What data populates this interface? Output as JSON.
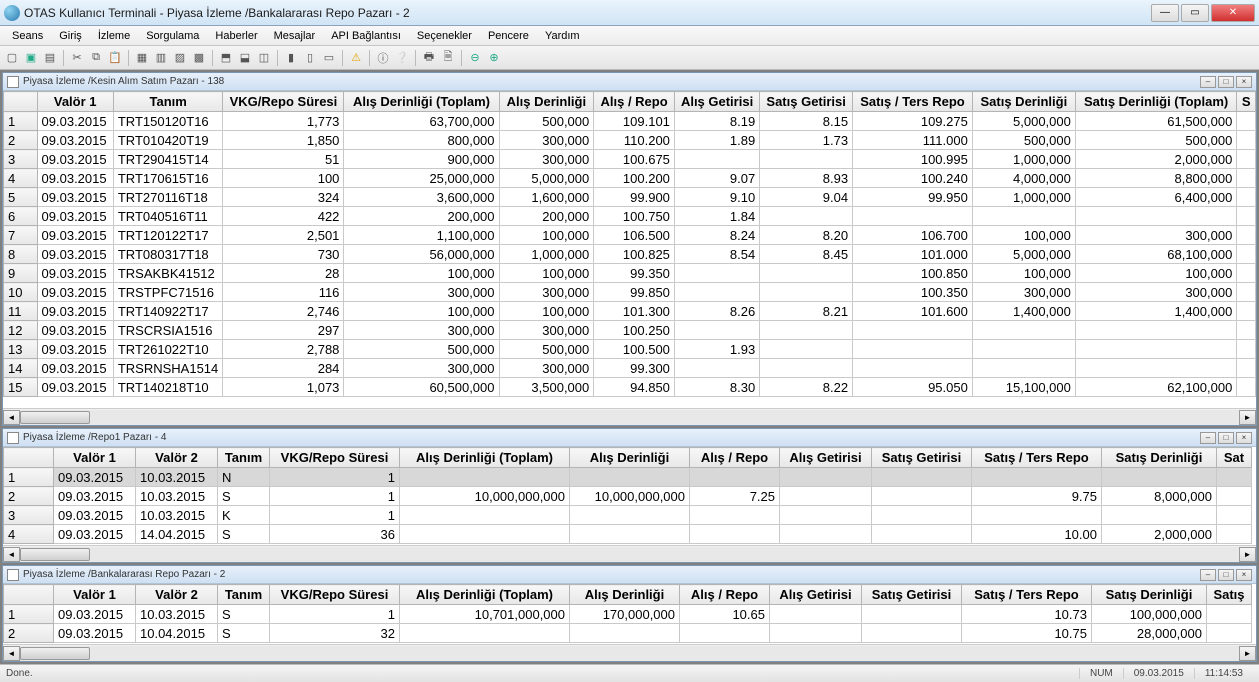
{
  "app": {
    "title": "OTAS Kullanıcı Terminali - Piyasa İzleme /Bankalararası Repo Pazarı - 2"
  },
  "menu": [
    "Seans",
    "Giriş",
    "İzleme",
    "Sorgulama",
    "Haberler",
    "Mesajlar",
    "API Bağlantısı",
    "Seçenekler",
    "Pencere",
    "Yardım"
  ],
  "panel1": {
    "title": "Piyasa İzleme /Kesin Alım Satım Pazarı - 138",
    "headers": [
      "",
      "Valör 1",
      "Tanım",
      "VKG/Repo Süresi",
      "Alış Derinliği (Toplam)",
      "Alış Derinliği",
      "Alış / Repo",
      "Alış Getirisi",
      "Satış Getirisi",
      "Satış / Ters Repo",
      "Satış Derinliği",
      "Satış Derinliği (Toplam)",
      "S"
    ],
    "rows": [
      {
        "n": "1",
        "valor1": "09.03.2015",
        "tanim": "TRT150120T16",
        "vkg": "1,773",
        "adt": "63,700,000",
        "ad": "500,000",
        "ar": "109.101",
        "ag": "8.19",
        "sg": "8.15",
        "str": "109.275",
        "sd": "5,000,000",
        "sdt": "61,500,000"
      },
      {
        "n": "2",
        "valor1": "09.03.2015",
        "tanim": "TRT010420T19",
        "vkg": "1,850",
        "adt": "800,000",
        "ad": "300,000",
        "ar": "110.200",
        "ag": "1.89",
        "sg": "1.73",
        "str": "111.000",
        "sd": "500,000",
        "sdt": "500,000"
      },
      {
        "n": "3",
        "valor1": "09.03.2015",
        "tanim": "TRT290415T14",
        "vkg": "51",
        "adt": "900,000",
        "ad": "300,000",
        "ar": "100.675",
        "ag": "",
        "sg": "",
        "str": "100.995",
        "sd": "1,000,000",
        "sdt": "2,000,000"
      },
      {
        "n": "4",
        "valor1": "09.03.2015",
        "tanim": "TRT170615T16",
        "vkg": "100",
        "adt": "25,000,000",
        "ad": "5,000,000",
        "ar": "100.200",
        "ag": "9.07",
        "sg": "8.93",
        "str": "100.240",
        "sd": "4,000,000",
        "sdt": "8,800,000"
      },
      {
        "n": "5",
        "valor1": "09.03.2015",
        "tanim": "TRT270116T18",
        "vkg": "324",
        "adt": "3,600,000",
        "ad": "1,600,000",
        "ar": "99.900",
        "ag": "9.10",
        "sg": "9.04",
        "str": "99.950",
        "sd": "1,000,000",
        "sdt": "6,400,000"
      },
      {
        "n": "6",
        "valor1": "09.03.2015",
        "tanim": "TRT040516T11",
        "vkg": "422",
        "adt": "200,000",
        "ad": "200,000",
        "ar": "100.750",
        "ag": "1.84",
        "sg": "",
        "str": "",
        "sd": "",
        "sdt": ""
      },
      {
        "n": "7",
        "valor1": "09.03.2015",
        "tanim": "TRT120122T17",
        "vkg": "2,501",
        "adt": "1,100,000",
        "ad": "100,000",
        "ar": "106.500",
        "ag": "8.24",
        "sg": "8.20",
        "str": "106.700",
        "sd": "100,000",
        "sdt": "300,000"
      },
      {
        "n": "8",
        "valor1": "09.03.2015",
        "tanim": "TRT080317T18",
        "vkg": "730",
        "adt": "56,000,000",
        "ad": "1,000,000",
        "ar": "100.825",
        "ag": "8.54",
        "sg": "8.45",
        "str": "101.000",
        "sd": "5,000,000",
        "sdt": "68,100,000"
      },
      {
        "n": "9",
        "valor1": "09.03.2015",
        "tanim": "TRSAKBK41512",
        "vkg": "28",
        "adt": "100,000",
        "ad": "100,000",
        "ar": "99.350",
        "ag": "",
        "sg": "",
        "str": "100.850",
        "sd": "100,000",
        "sdt": "100,000"
      },
      {
        "n": "10",
        "valor1": "09.03.2015",
        "tanim": "TRSTPFC71516",
        "vkg": "116",
        "adt": "300,000",
        "ad": "300,000",
        "ar": "99.850",
        "ag": "",
        "sg": "",
        "str": "100.350",
        "sd": "300,000",
        "sdt": "300,000"
      },
      {
        "n": "11",
        "valor1": "09.03.2015",
        "tanim": "TRT140922T17",
        "vkg": "2,746",
        "adt": "100,000",
        "ad": "100,000",
        "ar": "101.300",
        "ag": "8.26",
        "sg": "8.21",
        "str": "101.600",
        "sd": "1,400,000",
        "sdt": "1,400,000"
      },
      {
        "n": "12",
        "valor1": "09.03.2015",
        "tanim": "TRSCRSIA1516",
        "vkg": "297",
        "adt": "300,000",
        "ad": "300,000",
        "ar": "100.250",
        "ag": "",
        "sg": "",
        "str": "",
        "sd": "",
        "sdt": ""
      },
      {
        "n": "13",
        "valor1": "09.03.2015",
        "tanim": "TRT261022T10",
        "vkg": "2,788",
        "adt": "500,000",
        "ad": "500,000",
        "ar": "100.500",
        "ag": "1.93",
        "sg": "",
        "str": "",
        "sd": "",
        "sdt": ""
      },
      {
        "n": "14",
        "valor1": "09.03.2015",
        "tanim": "TRSRNSHA1514",
        "vkg": "284",
        "adt": "300,000",
        "ad": "300,000",
        "ar": "99.300",
        "ag": "",
        "sg": "",
        "str": "",
        "sd": "",
        "sdt": ""
      },
      {
        "n": "15",
        "valor1": "09.03.2015",
        "tanim": "TRT140218T10",
        "vkg": "1,073",
        "adt": "60,500,000",
        "ad": "3,500,000",
        "ar": "94.850",
        "ag": "8.30",
        "sg": "8.22",
        "str": "95.050",
        "sd": "15,100,000",
        "sdt": "62,100,000"
      }
    ]
  },
  "panel2": {
    "title": "Piyasa İzleme /Repo1 Pazarı - 4",
    "headers": [
      "",
      "Valör 1",
      "Valör 2",
      "Tanım",
      "VKG/Repo Süresi",
      "Alış Derinliği (Toplam)",
      "Alış Derinliği",
      "Alış / Repo",
      "Alış Getirisi",
      "Satış Getirisi",
      "Satış / Ters Repo",
      "Satış Derinliği",
      "Sat"
    ],
    "rows": [
      {
        "sel": true,
        "n": "1",
        "valor1": "09.03.2015",
        "valor2": "10.03.2015",
        "tanim": "N",
        "vkg": "1",
        "adt": "",
        "ad": "",
        "ar": "",
        "ag": "",
        "sg": "",
        "str": "",
        "sd": ""
      },
      {
        "n": "2",
        "valor1": "09.03.2015",
        "valor2": "10.03.2015",
        "tanim": "S",
        "vkg": "1",
        "adt": "10,000,000,000",
        "ad": "10,000,000,000",
        "ar": "7.25",
        "ag": "",
        "sg": "",
        "str": "9.75",
        "sd": "8,000,000"
      },
      {
        "n": "3",
        "valor1": "09.03.2015",
        "valor2": "10.03.2015",
        "tanim": "K",
        "vkg": "1",
        "adt": "",
        "ad": "",
        "ar": "",
        "ag": "",
        "sg": "",
        "str": "",
        "sd": ""
      },
      {
        "n": "4",
        "valor1": "09.03.2015",
        "valor2": "14.04.2015",
        "tanim": "S",
        "vkg": "36",
        "adt": "",
        "ad": "",
        "ar": "",
        "ag": "",
        "sg": "",
        "str": "10.00",
        "sd": "2,000,000"
      }
    ]
  },
  "panel3": {
    "title": "Piyasa İzleme /Bankalararası Repo Pazarı - 2",
    "headers": [
      "",
      "Valör 1",
      "Valör 2",
      "Tanım",
      "VKG/Repo Süresi",
      "Alış Derinliği (Toplam)",
      "Alış Derinliği",
      "Alış / Repo",
      "Alış Getirisi",
      "Satış Getirisi",
      "Satış / Ters Repo",
      "Satış Derinliği",
      "Satış"
    ],
    "rows": [
      {
        "n": "1",
        "valor1": "09.03.2015",
        "valor2": "10.03.2015",
        "tanim": "S",
        "vkg": "1",
        "adt": "10,701,000,000",
        "ad": "170,000,000",
        "ar": "10.65",
        "ag": "",
        "sg": "",
        "str": "10.73",
        "sd": "100,000,000"
      },
      {
        "n": "2",
        "valor1": "09.03.2015",
        "valor2": "10.04.2015",
        "tanim": "S",
        "vkg": "32",
        "adt": "",
        "ad": "",
        "ar": "",
        "ag": "",
        "sg": "",
        "str": "10.75",
        "sd": "28,000,000"
      }
    ]
  },
  "status": {
    "left": "Done.",
    "num": "NUM",
    "date": "09.03.2015",
    "time": "11:14:53"
  }
}
